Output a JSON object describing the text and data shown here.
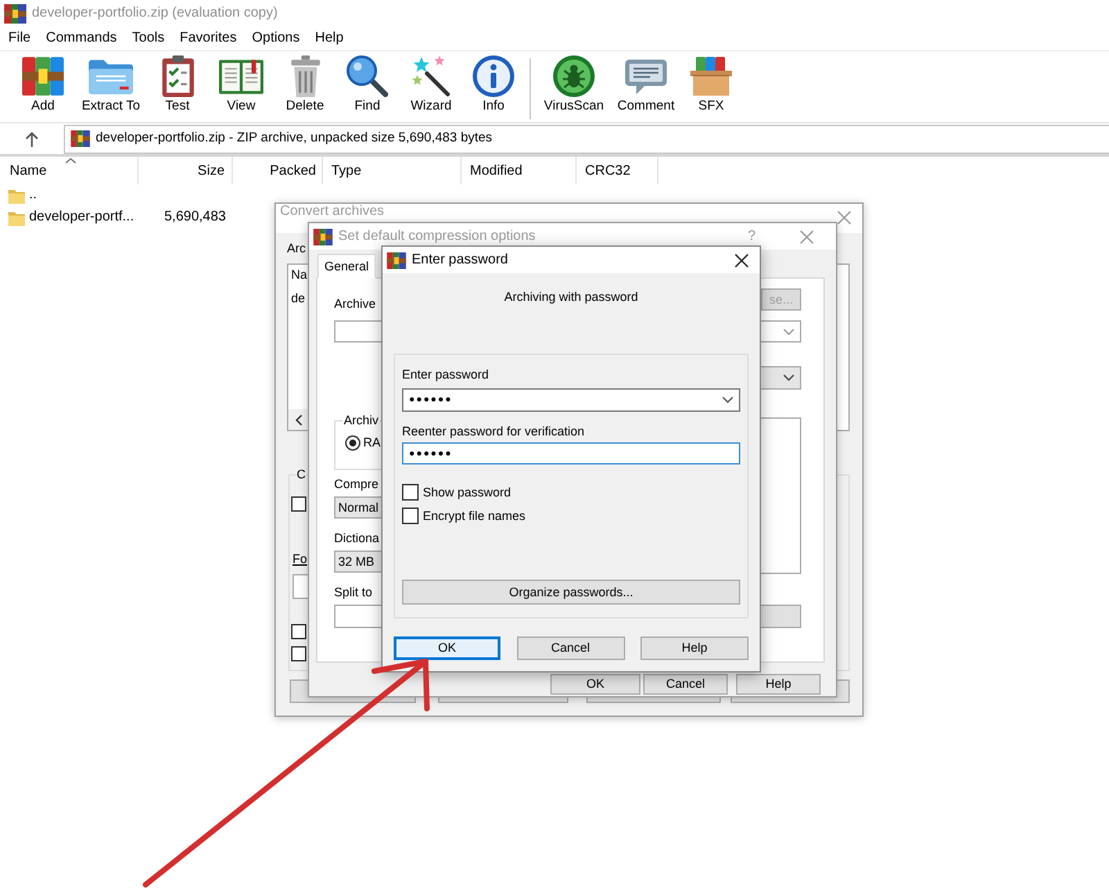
{
  "window": {
    "title": "developer-portfolio.zip (evaluation copy)",
    "active": false
  },
  "menu": [
    "File",
    "Commands",
    "Tools",
    "Favorites",
    "Options",
    "Help"
  ],
  "toolbar": [
    [
      {
        "label": "Add"
      },
      {
        "label": "Extract To"
      },
      {
        "label": "Test"
      },
      {
        "label": "View"
      },
      {
        "label": "Delete"
      },
      {
        "label": "Find"
      },
      {
        "label": "Wizard"
      },
      {
        "label": "Info"
      }
    ],
    [
      {
        "label": "VirusScan"
      },
      {
        "label": "Comment"
      },
      {
        "label": "SFX"
      }
    ]
  ],
  "address_bar": {
    "text": "developer-portfolio.zip - ZIP archive, unpacked size 5,690,483 bytes"
  },
  "file_list": {
    "columns": [
      {
        "label": "Name",
        "sorted": true
      },
      {
        "label": "Size",
        "sorted": false
      },
      {
        "label": "Packed",
        "sorted": false
      },
      {
        "label": "Type",
        "sorted": false
      },
      {
        "label": "Modified",
        "sorted": false
      },
      {
        "label": "CRC32",
        "sorted": false
      }
    ],
    "rows": [
      {
        "name": ".."
      },
      {
        "name": "developer-portf...",
        "size": "5,690,483"
      }
    ]
  },
  "convert_dialog": {
    "title": "Convert archives",
    "active": false,
    "archives_label": "Arc",
    "list_header": "Na",
    "list_row": "de",
    "group_label": "C",
    "folder_label": "Fo",
    "checkboxes": [
      {
        "checked": false
      },
      {
        "checked": false
      },
      {
        "checked": false
      }
    ]
  },
  "compression_dialog": {
    "title": "Set default compression options",
    "active": false,
    "help": "?",
    "tabs": [
      {
        "label": "General",
        "selected": true
      }
    ],
    "archive_label": "Archive",
    "browse_button": {
      "label": "se...",
      "disabled": true
    },
    "format_group": "Archiv",
    "formats": [
      {
        "label": "RA",
        "selected": true
      }
    ],
    "method_label": "Compre",
    "method": "Normal",
    "dictionary_label": "Dictiona",
    "dictionary": "32 MB",
    "split_label": "Split to",
    "buttons": [
      "OK",
      "Cancel",
      "Help"
    ]
  },
  "password_dialog": {
    "title": "Enter password",
    "active": true,
    "heading": "Archiving with password",
    "password": {
      "label": "Enter password",
      "value": "●●●●●●",
      "focused": false
    },
    "confirm": {
      "label": "Reenter password for verification",
      "value": "●●●●●●",
      "focused": true
    },
    "options": [
      {
        "label": "Show password",
        "checked": false
      },
      {
        "label": "Encrypt file names",
        "checked": false
      }
    ],
    "organize_button": "Organize passwords...",
    "buttons": [
      {
        "label": "OK",
        "focused": true
      },
      {
        "label": "Cancel",
        "focused": false
      },
      {
        "label": "Help",
        "focused": false
      }
    ]
  }
}
